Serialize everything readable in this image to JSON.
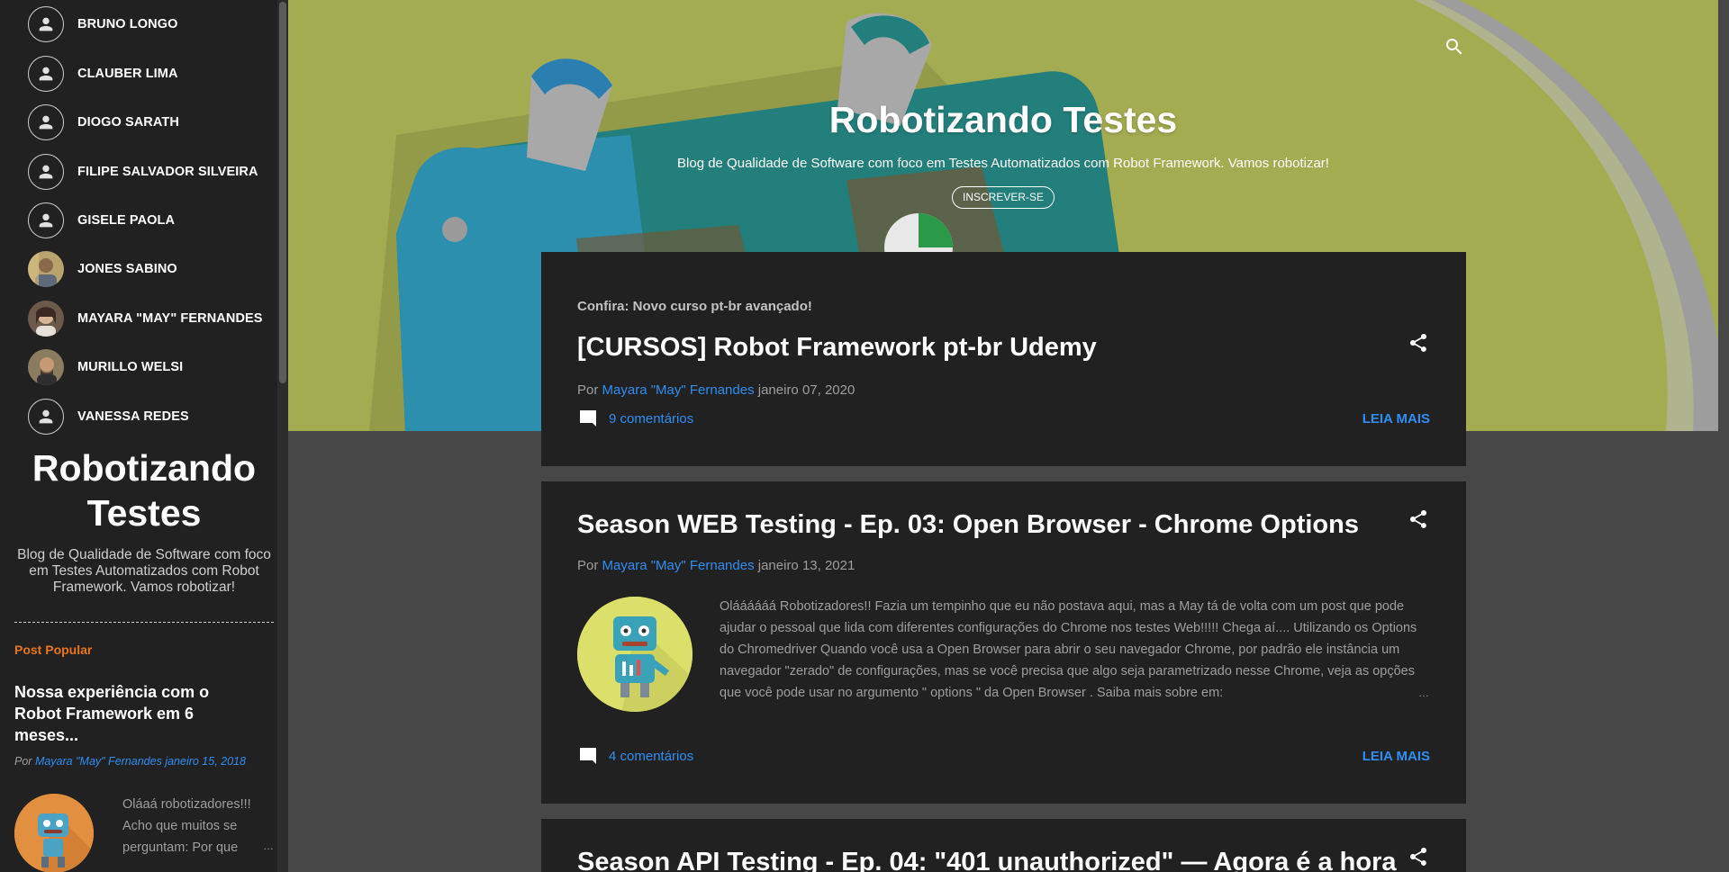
{
  "sidebar": {
    "authors": [
      {
        "name": "BRUNO LONGO",
        "avatar": "default"
      },
      {
        "name": "CLAUBER LIMA",
        "avatar": "default"
      },
      {
        "name": "DIOGO SARATH",
        "avatar": "default"
      },
      {
        "name": "FILIPE SALVADOR SILVEIRA",
        "avatar": "default"
      },
      {
        "name": "GISELE PAOLA",
        "avatar": "default"
      },
      {
        "name": "JONES SABINO",
        "avatar": "photo"
      },
      {
        "name": "MAYARA \"MAY\" FERNANDES",
        "avatar": "photo"
      },
      {
        "name": "MURILLO WELSI",
        "avatar": "photo"
      },
      {
        "name": "VANESSA REDES",
        "avatar": "default"
      }
    ],
    "blog_title": "Robotizando Testes",
    "blog_description": "Blog de Qualidade de Software com foco em Testes Automatizados com Robot Framework. Vamos robotizar!",
    "popular": {
      "label": "Post Popular",
      "title": "Nossa experiência com o Robot Framework em 6 meses...",
      "by": "Por",
      "author": "Mayara \"May\" Fernandes",
      "date": "janeiro 15, 2018",
      "snippet": "Oláaá robotizadores!!! Acho que muitos se perguntam: Por que",
      "ellipsis": "…"
    }
  },
  "hero": {
    "title": "Robotizando Testes",
    "description": "Blog de Qualidade de Software com foco em Testes Automatizados com Robot Framework. Vamos robotizar!",
    "subscribe_label": "INSCREVER-SE",
    "search_icon": "search-icon"
  },
  "posts": [
    {
      "label": "Confira: Novo curso pt-br avançado!",
      "title": "[CURSOS] Robot Framework pt-br Udemy",
      "by": "Por",
      "author": "Mayara \"May\" Fernandes",
      "date": "janeiro 07, 2020",
      "comments": "9 comentários",
      "read_more": "LEIA MAIS"
    },
    {
      "title": "Season WEB Testing - Ep. 03: Open Browser - Chrome Options",
      "by": "Por",
      "author": "Mayara \"May\" Fernandes",
      "date": "janeiro 13, 2021",
      "snippet": "Oláááááá Robotizadores!! Fazia um tempinho que eu não postava aqui, mas a May tá de volta com um post que pode ajudar o pessoal que lida com diferentes configurações do Chrome nos testes Web!!!!! Chega aí.... Utilizando os Options do Chromedriver Quando você usa a Open Browser para abrir o seu navegador Chrome, por padrão ele instância um navegador \"zerado\" de configurações, mas se você precisa que algo seja parametrizado nesse Chrome, veja as opções que você pode usar no argumento \" options \" da Open Browser . Saiba mais sobre em:",
      "ellipsis": "…",
      "comments": "4 comentários",
      "read_more": "LEIA MAIS"
    },
    {
      "title": "Season API Testing - Ep. 04: \"401 unauthorized\" — Agora é a hora"
    }
  ],
  "colors": {
    "background": "#474747",
    "card": "#212121",
    "accent_link": "#2f8ef2",
    "popular_label": "#e9761d",
    "hero_bg": "#a4ac51"
  }
}
